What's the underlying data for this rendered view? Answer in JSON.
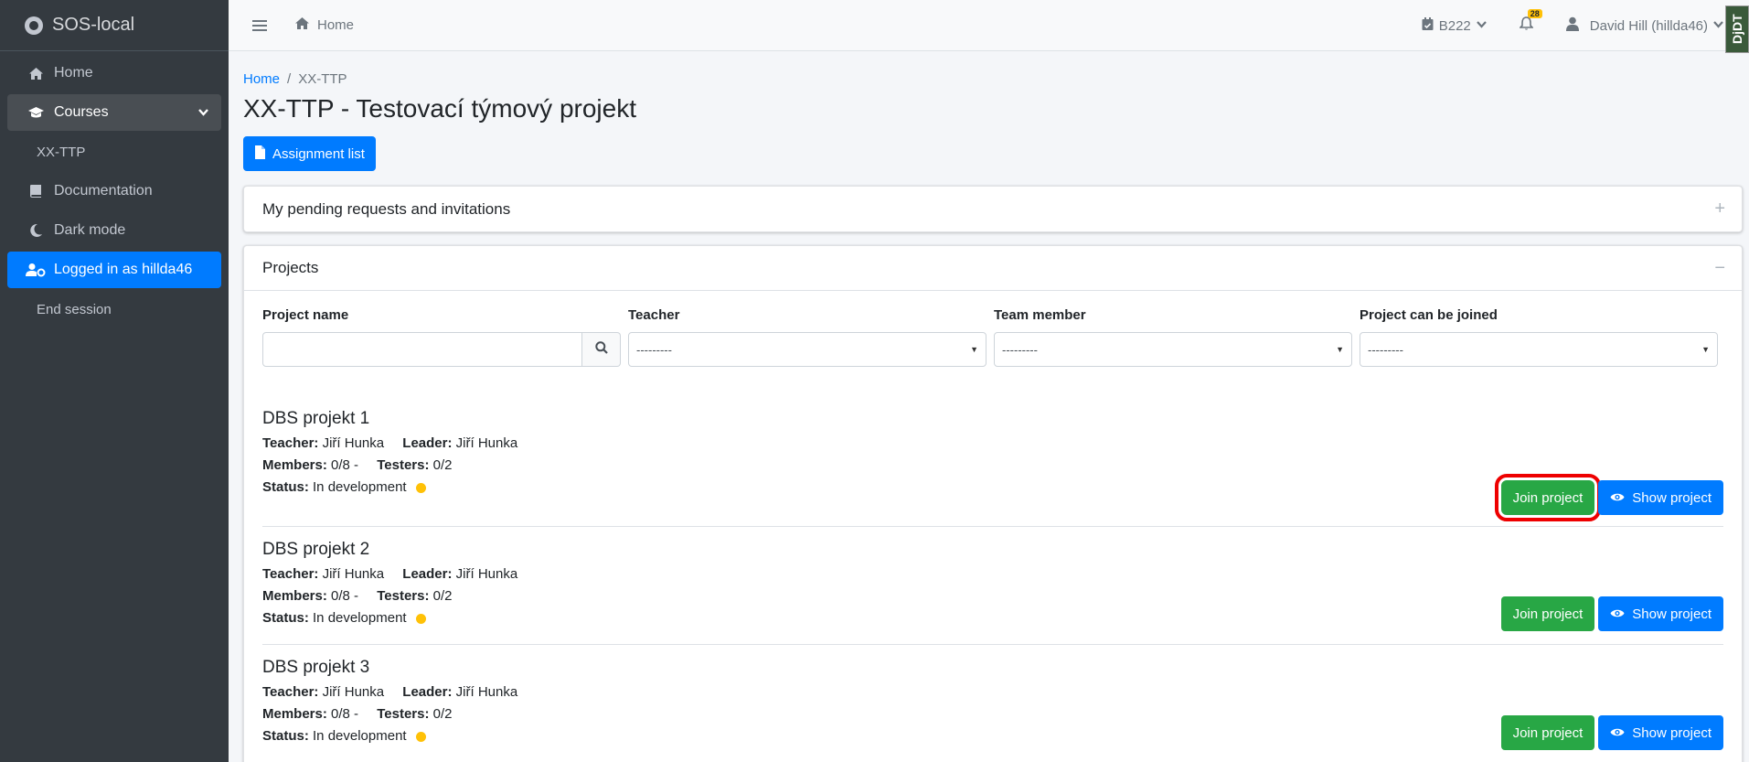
{
  "sidebar": {
    "brand": "SOS-local",
    "items": [
      {
        "label": "Home",
        "icon": "home-icon"
      },
      {
        "label": "Courses",
        "icon": "graduation-cap-icon"
      },
      {
        "label": "XX-TTP"
      },
      {
        "label": "Documentation",
        "icon": "book-icon"
      },
      {
        "label": "Dark mode",
        "icon": "moon-icon"
      },
      {
        "label": "Logged in as hillda46",
        "icon": "user-cog-icon"
      },
      {
        "label": "End session"
      }
    ]
  },
  "navbar": {
    "home": "Home",
    "semester": "B222",
    "notifications": "28",
    "user": "David Hill (hillda46)",
    "ddt": "DjDT"
  },
  "breadcrumb": {
    "home": "Home",
    "current": "XX-TTP"
  },
  "page_title": "XX-TTP - Testovací týmový projekt",
  "assignment_list": "Assignment list",
  "pending_card": {
    "title": "My pending requests and invitations",
    "tool": "+"
  },
  "projects_card": {
    "title": "Projects",
    "tool": "−"
  },
  "filters": {
    "project_name": {
      "label": "Project name",
      "value": ""
    },
    "teacher": {
      "label": "Teacher",
      "value": "---------"
    },
    "team_member": {
      "label": "Team member",
      "value": "---------"
    },
    "can_join": {
      "label": "Project can be joined",
      "value": "---------"
    }
  },
  "labels": {
    "teacher": "Teacher:",
    "leader": "Leader:",
    "members": "Members:",
    "testers": "Testers:",
    "status": "Status:",
    "join": "Join project",
    "show": "Show project"
  },
  "projects": [
    {
      "name": "DBS projekt 1",
      "teacher": "Jiří Hunka",
      "leader": "Jiří Hunka",
      "members": "0/8 -",
      "testers": "0/2",
      "status": "In development"
    },
    {
      "name": "DBS projekt 2",
      "teacher": "Jiří Hunka",
      "leader": "Jiří Hunka",
      "members": "0/8 -",
      "testers": "0/2",
      "status": "In development"
    },
    {
      "name": "DBS projekt 3",
      "teacher": "Jiří Hunka",
      "leader": "Jiří Hunka",
      "members": "0/8 -",
      "testers": "0/2",
      "status": "In development"
    }
  ],
  "colors": {
    "primary": "#007bff",
    "success": "#28a745",
    "sidebar_bg": "#343a40",
    "status_dot": "#ffc107",
    "highlight": "#ee0000"
  }
}
